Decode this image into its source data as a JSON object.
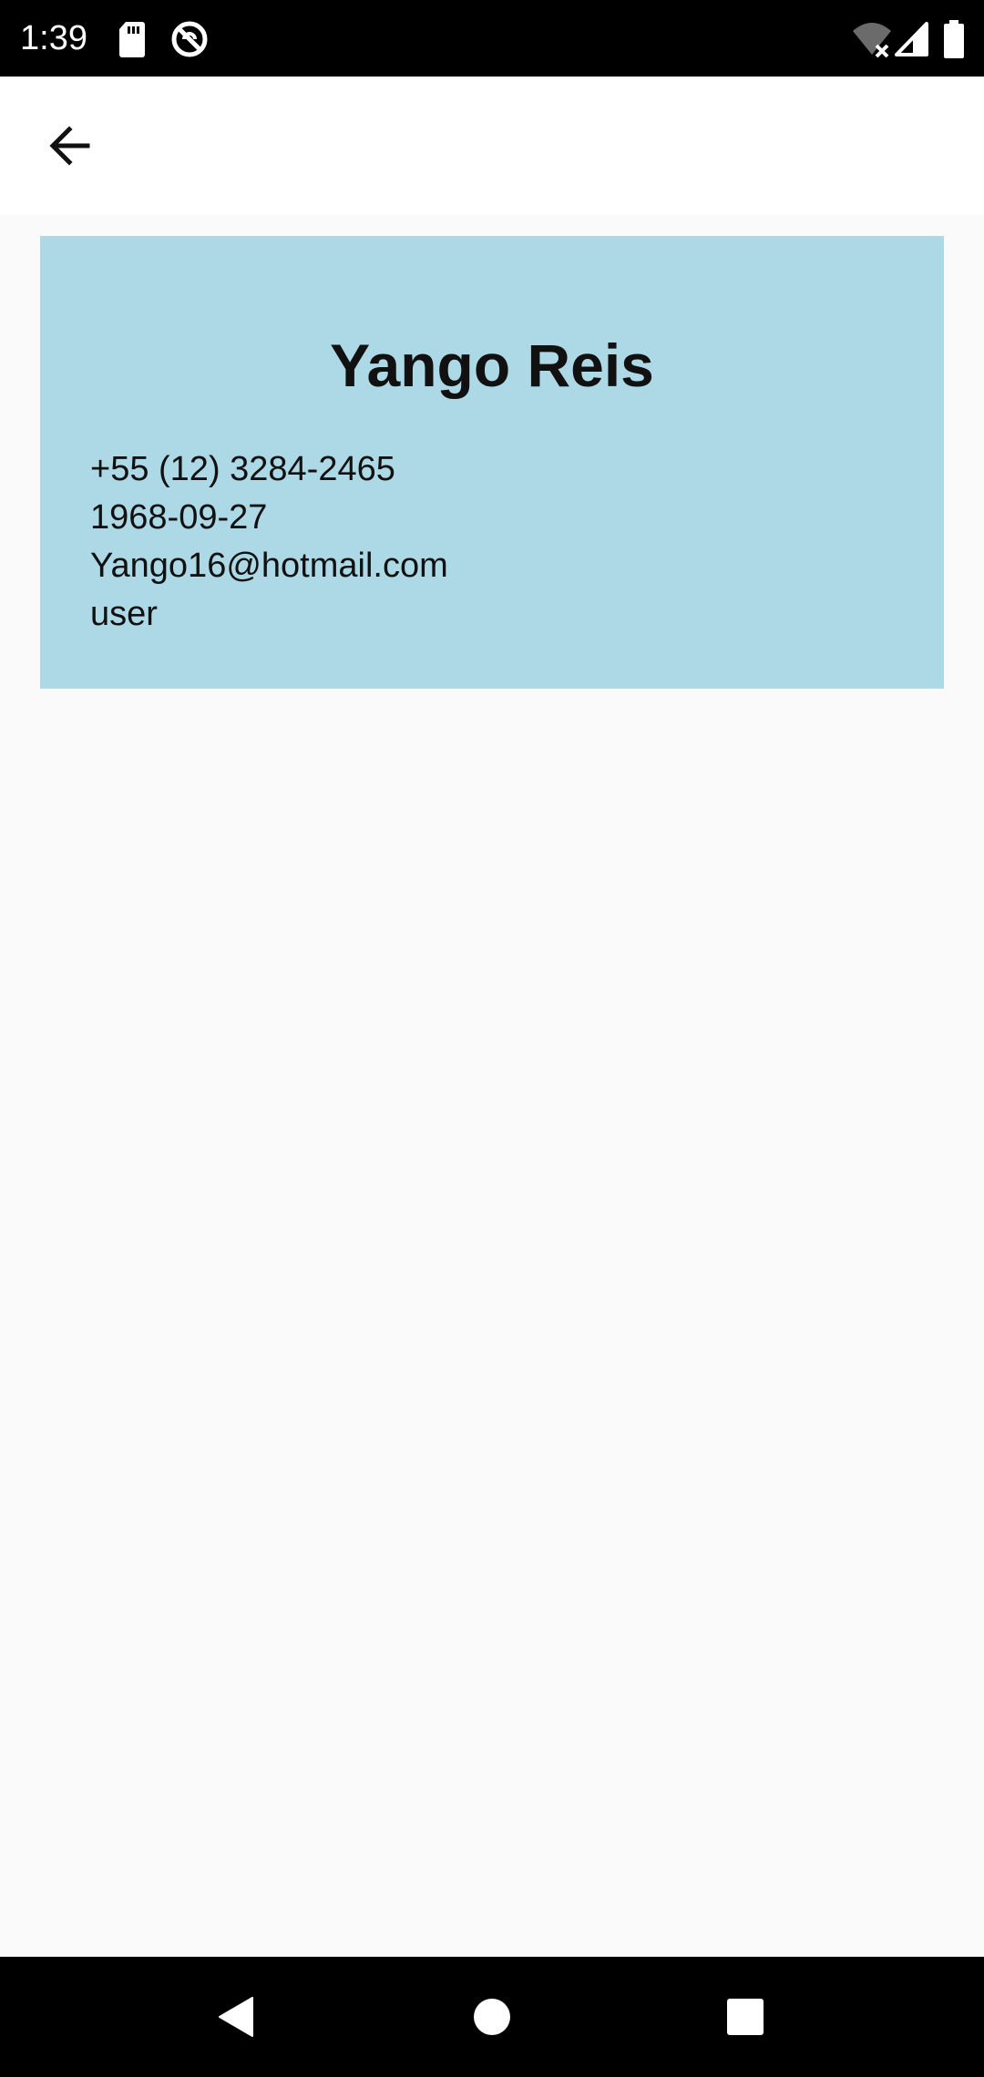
{
  "status_bar": {
    "time": "1:39",
    "icons": [
      "sd-card-icon",
      "do-not-disturb-icon",
      "wifi-off-icon",
      "cellular-signal-icon",
      "battery-icon"
    ]
  },
  "app_bar": {
    "back_icon": "arrow-back-icon"
  },
  "profile": {
    "name": "Yango Reis",
    "phone": "+55 (12) 3284-2465",
    "birth_date": "1968-09-27",
    "email": "Yango16@hotmail.com",
    "role": "user",
    "card_color": "#add8e6"
  },
  "nav_bar": {
    "icons": [
      "nav-back-icon",
      "nav-home-icon",
      "nav-recents-icon"
    ]
  }
}
